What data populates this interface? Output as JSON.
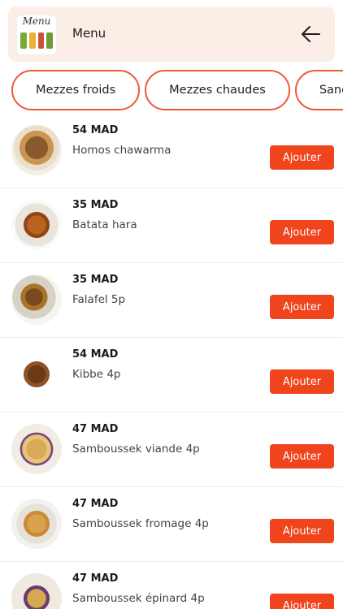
{
  "header": {
    "logo_text": "Menu",
    "title": "Menu",
    "back_icon": "arrow-left-icon"
  },
  "tabs": [
    {
      "label": "Mezzes froids"
    },
    {
      "label": "Mezzes chaudes"
    },
    {
      "label": "Sandwichs"
    }
  ],
  "items": [
    {
      "price": "54 MAD",
      "name": "Homos chawarma",
      "button": "Ajouter"
    },
    {
      "price": "35 MAD",
      "name": "Batata hara",
      "button": "Ajouter"
    },
    {
      "price": "35 MAD",
      "name": "Falafel 5p",
      "button": "Ajouter"
    },
    {
      "price": "54 MAD",
      "name": "Kibbe 4p",
      "button": "Ajouter"
    },
    {
      "price": "47 MAD",
      "name": "Samboussek viande 4p",
      "button": "Ajouter"
    },
    {
      "price": "47 MAD",
      "name": "Samboussek fromage 4p",
      "button": "Ajouter"
    },
    {
      "price": "47 MAD",
      "name": "Samboussek épinard 4p",
      "button": "Ajouter"
    }
  ],
  "colors": {
    "accent": "#f0441c",
    "tab_border": "#f0583a",
    "header_bg": "#fbeee6"
  }
}
